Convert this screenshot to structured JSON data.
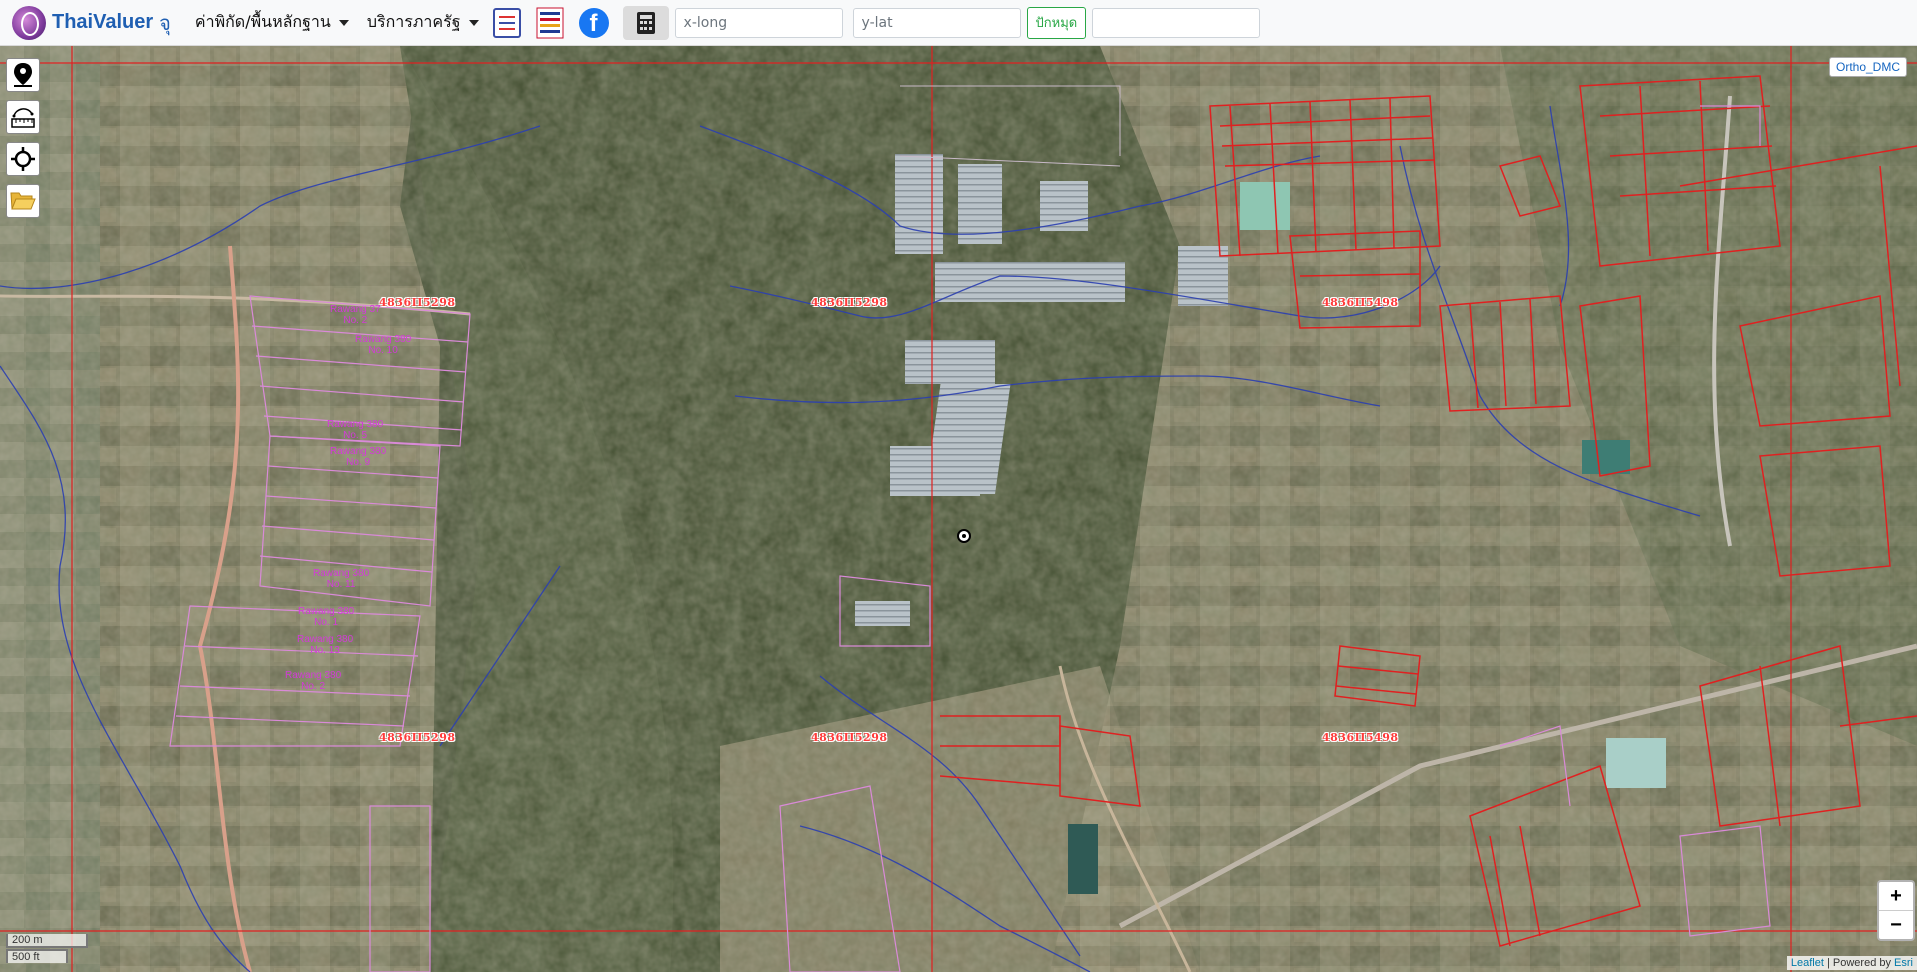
{
  "navbar": {
    "brand_name": "ThaiValuer",
    "brand_sub": "จุ",
    "menu_price": "ค่าพิกัด/พื้นหลักฐาน",
    "menu_services": "บริการภาครัฐ",
    "calculator_icon": "calculator-icon",
    "facebook_icon": "facebook-icon",
    "xlong_placeholder": "x-long",
    "ylat_placeholder": "y-lat",
    "pin_button": "ปักหมุด"
  },
  "map": {
    "layer_name": "Ortho_DMC",
    "sheet_labels": [
      "4836II5298",
      "4836II5298",
      "4836II5498",
      "4836II5298",
      "4836II5298",
      "4836II5498"
    ],
    "plot_labels": [
      "Rawang 37\nNo. 2",
      "Rawang 380\nNo. 10",
      "Rawang 380\nNo. 11",
      "Rawang 380\nNo. 1",
      "Rawang 380\nNo. 13",
      "Rawang 380\nNo. 2",
      "Rawang 380\nNo. 9",
      "Rawang 380\nNo. 5"
    ],
    "controls": {
      "locate_icon": "location-pin-icon",
      "measure_icon": "ruler-icon",
      "gps_icon": "crosshair-icon",
      "folder_icon": "folder-icon"
    },
    "zoom_in": "+",
    "zoom_out": "−",
    "scale_metric": "200 m",
    "scale_imperial": "500 ft",
    "attribution_leaflet": "Leaflet",
    "attribution_sep": " | Powered by ",
    "attribution_esri": "Esri",
    "colors": {
      "parcel_red": "#e02020",
      "parcel_pink": "#d98ad8",
      "stream_blue": "#2b3fb0",
      "brand_blue": "#1f5fb2"
    }
  }
}
